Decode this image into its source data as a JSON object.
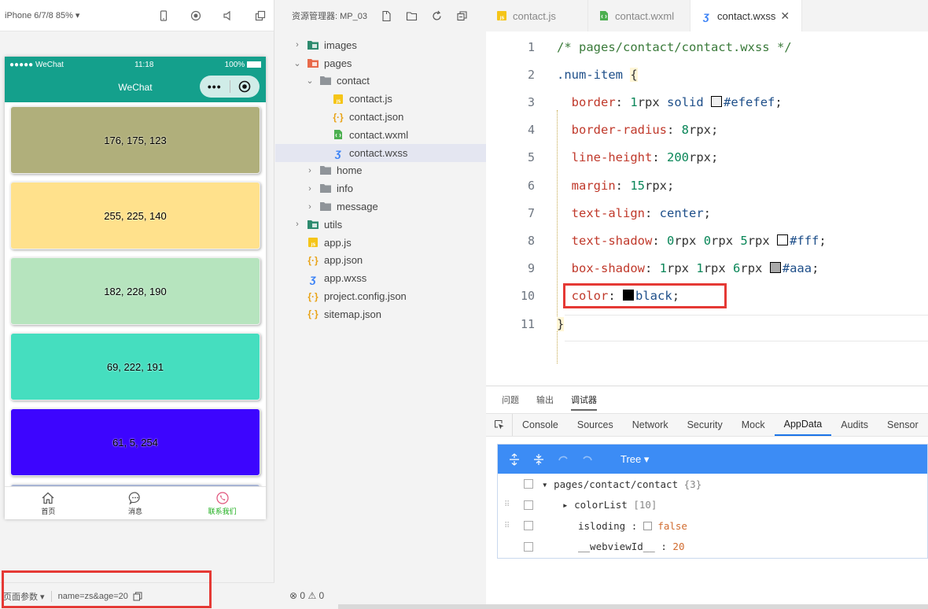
{
  "simulator": {
    "device": "iPhone 6/7/8 85% ▾",
    "status_left": "●●●●● WeChat",
    "status_time": "11:18",
    "status_battery": "100%",
    "nav_title": "WeChat",
    "capsule_dots": "•••",
    "items": [
      {
        "label": "176, 175, 123",
        "color": "#b0af7b"
      },
      {
        "label": "255, 225, 140",
        "color": "#ffe18c"
      },
      {
        "label": "182, 228, 190",
        "color": "#b6e4be"
      },
      {
        "label": "69, 222, 191",
        "color": "#45debf"
      },
      {
        "label": "61, 5, 254",
        "color": "#3d05fe"
      },
      {
        "label": "",
        "color": "#a8b4d4"
      }
    ],
    "tabbar": [
      {
        "label": "首页",
        "icon": "home-icon"
      },
      {
        "label": "消息",
        "icon": "message-icon"
      },
      {
        "label": "联系我们",
        "icon": "contact-icon"
      }
    ],
    "page_params_label": "页面参数 ▾",
    "page_params_value": "name=zs&age=20"
  },
  "explorer": {
    "title": "资源管理器: MP_03",
    "tree": [
      {
        "label": "images",
        "type": "folder-green",
        "indent": 0,
        "chev": "›"
      },
      {
        "label": "pages",
        "type": "folder-red",
        "indent": 0,
        "chev": "⌄"
      },
      {
        "label": "contact",
        "type": "folder",
        "indent": 1,
        "chev": "⌄"
      },
      {
        "label": "contact.js",
        "type": "js",
        "indent": 2,
        "chev": ""
      },
      {
        "label": "contact.json",
        "type": "json",
        "indent": 2,
        "chev": ""
      },
      {
        "label": "contact.wxml",
        "type": "wxml",
        "indent": 2,
        "chev": ""
      },
      {
        "label": "contact.wxss",
        "type": "wxss",
        "indent": 2,
        "chev": "",
        "selected": true
      },
      {
        "label": "home",
        "type": "folder",
        "indent": 1,
        "chev": "›"
      },
      {
        "label": "info",
        "type": "folder",
        "indent": 1,
        "chev": "›"
      },
      {
        "label": "message",
        "type": "folder",
        "indent": 1,
        "chev": "›"
      },
      {
        "label": "utils",
        "type": "folder-green",
        "indent": 0,
        "chev": "›"
      },
      {
        "label": "app.js",
        "type": "js",
        "indent": 0,
        "chev": ""
      },
      {
        "label": "app.json",
        "type": "json",
        "indent": 0,
        "chev": ""
      },
      {
        "label": "app.wxss",
        "type": "wxss",
        "indent": 0,
        "chev": ""
      },
      {
        "label": "project.config.json",
        "type": "json",
        "indent": 0,
        "chev": ""
      },
      {
        "label": "sitemap.json",
        "type": "json",
        "indent": 0,
        "chev": ""
      }
    ],
    "errors": "0",
    "warnings": "0"
  },
  "editor": {
    "tabs": [
      {
        "label": "contact.js",
        "type": "js"
      },
      {
        "label": "contact.wxml",
        "type": "wxml"
      },
      {
        "label": "contact.wxss",
        "type": "wxss",
        "active": true
      }
    ],
    "lines": [
      "/* pages/contact/contact.wxss */",
      ".num-item {",
      "border: 1rpx solid #efefef;",
      "border-radius: 8rpx;",
      "line-height: 200rpx;",
      "margin: 15rpx;",
      "text-align: center;",
      "text-shadow: 0rpx 0rpx 5rpx #fff;",
      "box-shadow: 1rpx 1rpx 6rpx #aaa;",
      "color: black;",
      "}"
    ]
  },
  "devtools": {
    "panel_tabs": [
      "问题",
      "输出",
      "调试器"
    ],
    "active_panel": "调试器",
    "tabs": [
      "Console",
      "Sources",
      "Network",
      "Security",
      "Mock",
      "AppData",
      "Audits",
      "Sensor"
    ],
    "active_tab": "AppData",
    "tree_label": "Tree ▾",
    "rows": {
      "root_path": "pages/contact/contact",
      "root_count": "{3}",
      "color_key": "colorList",
      "color_count": "[10]",
      "loading_key": "isloding",
      "loading_val": "false",
      "webview_key": "__webviewId__",
      "webview_val": "20"
    }
  }
}
